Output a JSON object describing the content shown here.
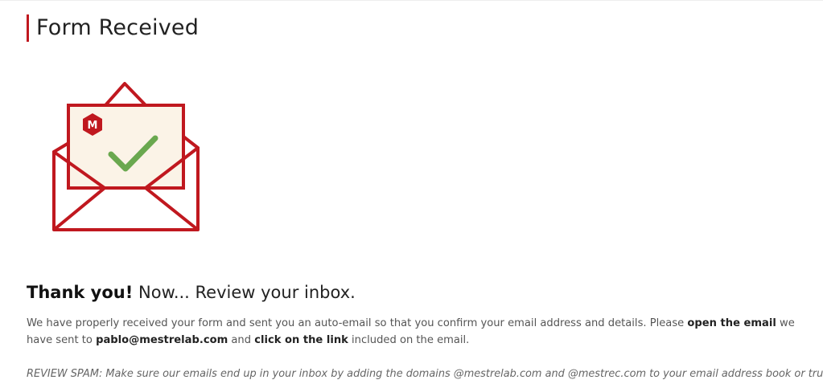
{
  "page": {
    "title": "Form Received"
  },
  "illustration": {
    "icon": "envelope-check-icon",
    "logo_letter": "M",
    "colors": {
      "envelope": "#c0181f",
      "paper": "#fbf3e7",
      "check": "#6aa84f"
    }
  },
  "confirmation": {
    "heading_strong": "Thank you!",
    "heading_rest": "Now... Review your inbox.",
    "body": {
      "part1": "We have properly received your form and sent you an auto-email so that you confirm your email address and details. Please ",
      "open_email": "open the email",
      "part2": " we have sent to ",
      "email": "pablo@mestrelab.com",
      "part3": " and ",
      "click_link": "click on the link",
      "part4": " included on the email."
    },
    "spam_note": "REVIEW SPAM: Make sure our emails end up in your inbox by adding the domains @mestrelab.com and @mestrec.com to your email address book or trusted-sender list"
  },
  "colors": {
    "accent": "#c0181f",
    "text": "#333333"
  }
}
